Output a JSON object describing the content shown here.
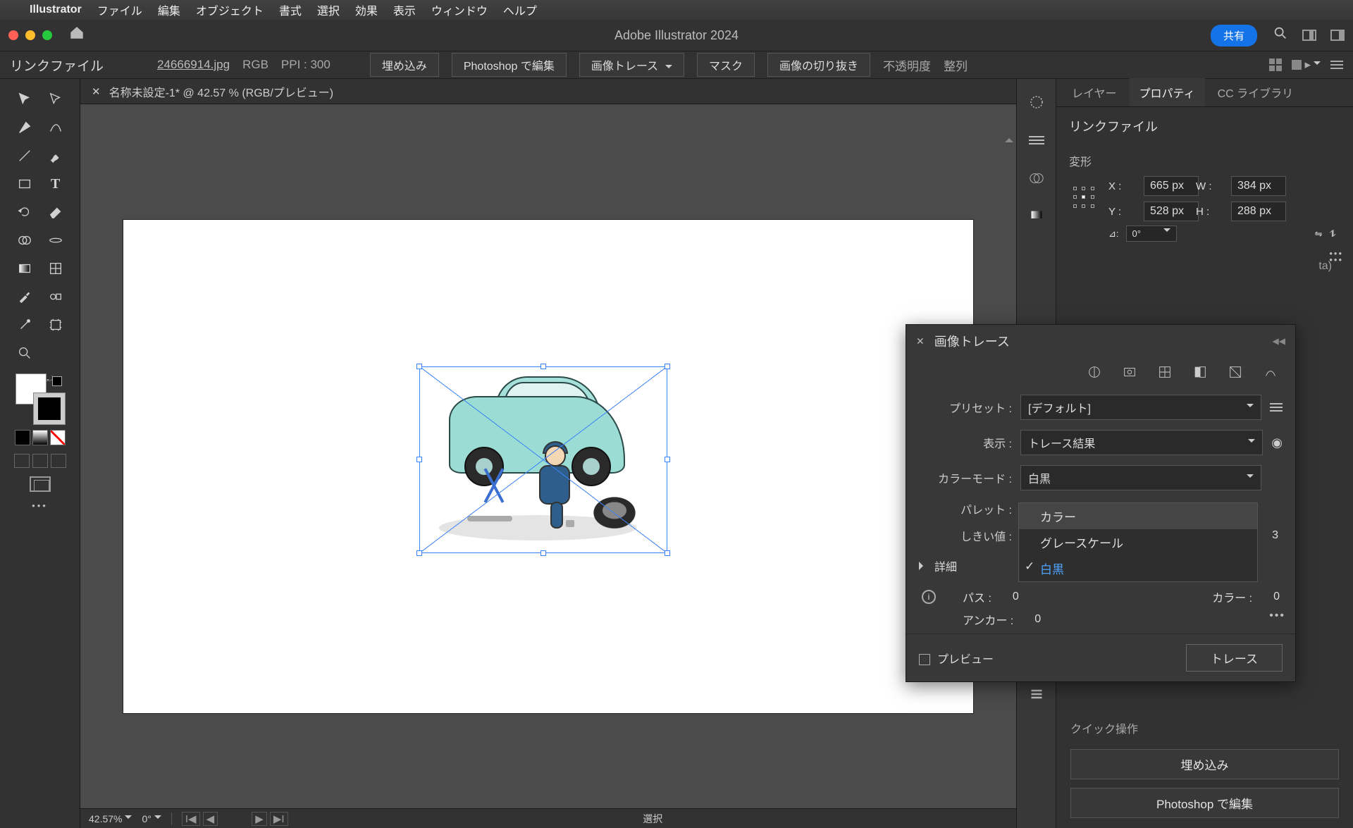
{
  "menubar": {
    "app": "Illustrator",
    "items": [
      "ファイル",
      "編集",
      "オブジェクト",
      "書式",
      "選択",
      "効果",
      "表示",
      "ウィンドウ",
      "ヘルプ"
    ]
  },
  "window": {
    "title": "Adobe Illustrator 2024",
    "share": "共有"
  },
  "controlbar": {
    "linked_label": "リンクファイル",
    "filename": "24666914.jpg",
    "colormode": "RGB",
    "ppi": "PPI : 300",
    "embed": "埋め込み",
    "edit_ps": "Photoshop で編集",
    "trace": "画像トレース",
    "mask": "マスク",
    "crop": "画像の切り抜き",
    "opacity": "不透明度",
    "align": "整列"
  },
  "doc_tab": "名称未設定-1* @ 42.57 % (RGB/プレビュー)",
  "status": {
    "zoom": "42.57%",
    "rotate": "0°",
    "label": "選択"
  },
  "panels": {
    "tabs": {
      "layers": "レイヤー",
      "properties": "プロパティ",
      "cclib": "CC ライブラリ"
    },
    "section_title": "リンクファイル",
    "transform_title": "変形",
    "x_label": "X :",
    "x_val": "665 px",
    "y_label": "Y :",
    "y_val": "528 px",
    "w_label": "W :",
    "w_val": "384 px",
    "h_label": "H :",
    "h_val": "288 px",
    "angle_label": "⊿:",
    "angle_val": "0°",
    "beta_suffix": "ta)",
    "quick_label": "クイック操作",
    "qa_embed": "埋め込み",
    "qa_ps": "Photoshop で編集"
  },
  "trace": {
    "title": "画像トレース",
    "preset_label": "プリセット :",
    "preset_val": "[デフォルト]",
    "view_label": "表示 :",
    "view_val": "トレース結果",
    "colormode_label": "カラーモード :",
    "colormode_val": "白黒",
    "palette_label": "パレット :",
    "threshold_label": "しきい値 :",
    "threshold_hint": "3",
    "dropdown": {
      "color": "カラー",
      "gray": "グレースケール",
      "bw": "白黒"
    },
    "detail": "詳細",
    "paths_label": "パス :",
    "paths_val": "0",
    "colors_label": "カラー :",
    "colors_val": "0",
    "anchors_label": "アンカー :",
    "anchors_val": "0",
    "preview": "プレビュー",
    "trace_btn": "トレース"
  }
}
